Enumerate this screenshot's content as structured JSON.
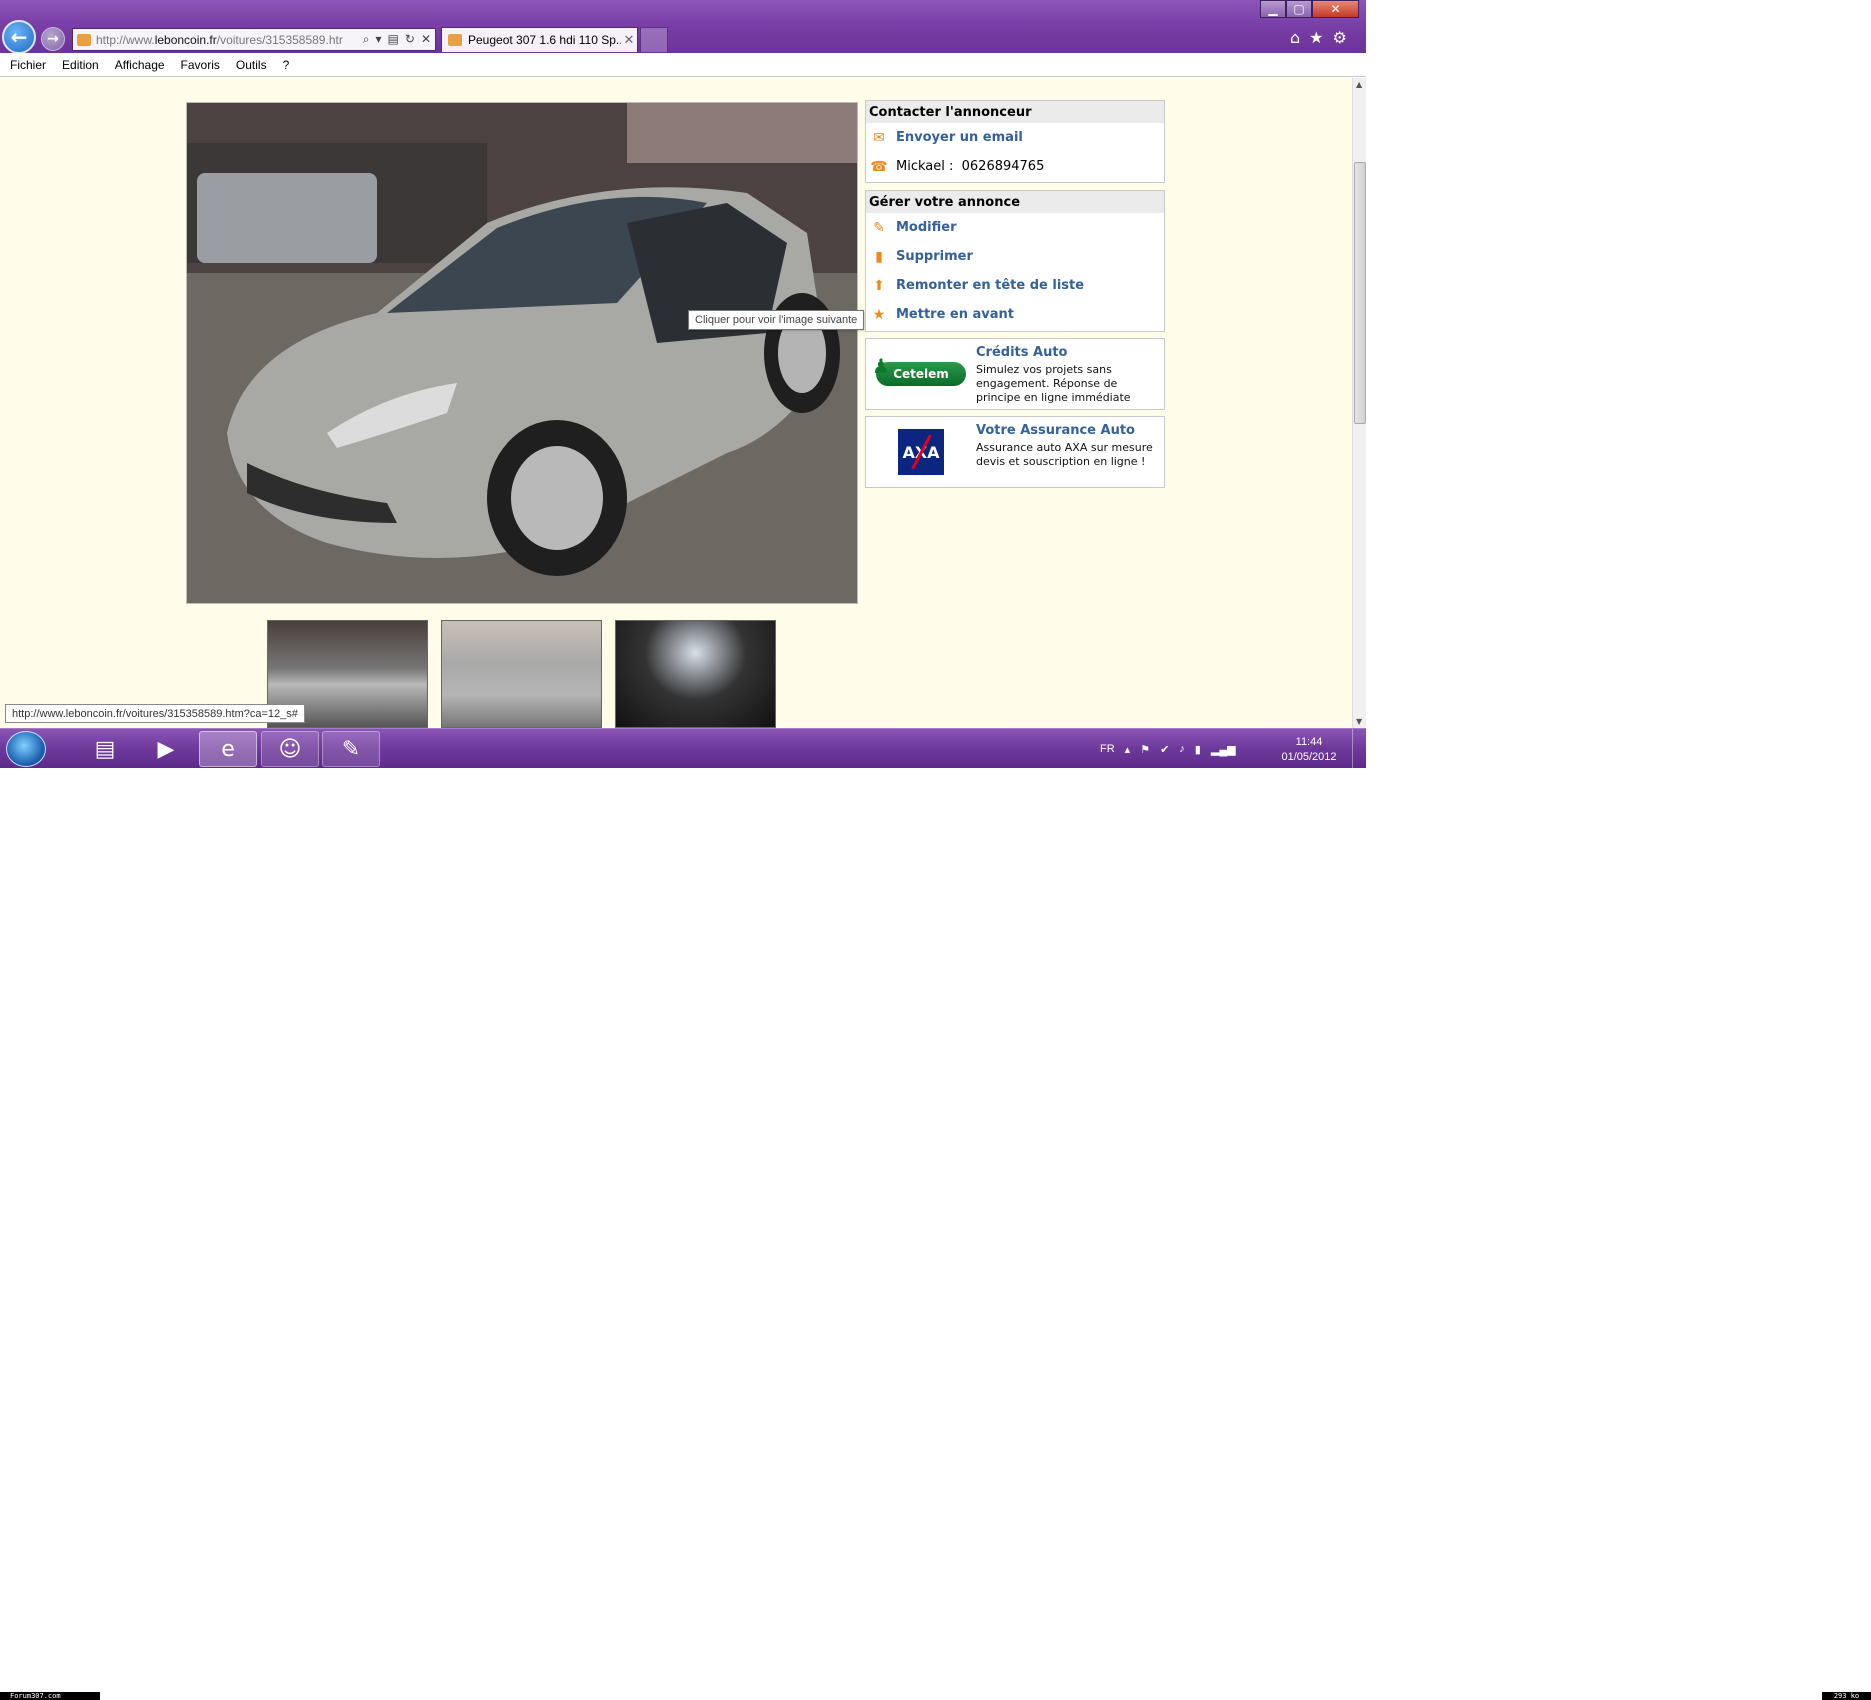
{
  "browser": {
    "address": {
      "prefix": "http://www.",
      "domain": "leboncoin.fr",
      "path": "/voitures/315358589.htr"
    },
    "tab_title": "Peugeot 307 1.6 hdi 110 Sp...",
    "tab_close": "✕",
    "window_controls": {
      "minimize": "▁",
      "maximize": "▢",
      "close": "✕"
    },
    "tool_icons": [
      "home-icon",
      "star-icon",
      "gear-icon"
    ]
  },
  "menubar": {
    "items": [
      "Fichier",
      "Edition",
      "Affichage",
      "Favoris",
      "Outils",
      "?"
    ]
  },
  "listing": {
    "photo_tooltip": "Cliquer pour voir l'image suivante",
    "contact": {
      "title": "Contacter l'annonceur",
      "email_link": "Envoyer un email",
      "phone_name": "Mickael :",
      "phone_number": "0626894765"
    },
    "manage": {
      "title": "Gérer votre annonce",
      "actions": [
        "Modifier",
        "Supprimer",
        "Remonter en tête de liste",
        "Mettre en avant"
      ]
    },
    "ads": [
      {
        "logo_text": "Cetelem",
        "title": "Crédits Auto",
        "description": "Simulez vos projets sans engagement. Réponse de principe en ligne immédiate"
      },
      {
        "logo_text": "AXA",
        "title": "Votre Assurance Auto",
        "description": "Assurance auto AXA sur mesure devis et souscription en ligne !"
      }
    ]
  },
  "status_url": "http://www.leboncoin.fr/voitures/315358589.htm?ca=12_s#",
  "taskbar": {
    "language": "FR",
    "time": "11:44",
    "date": "01/05/2012"
  },
  "watermarks": {
    "left": "Forum307.com",
    "right": "293 ko"
  },
  "colors": {
    "link": "#34619a",
    "page_background": "#fffde9",
    "chrome_purple": "#7a3fa8",
    "icon_orange": "#ee8a1b"
  }
}
